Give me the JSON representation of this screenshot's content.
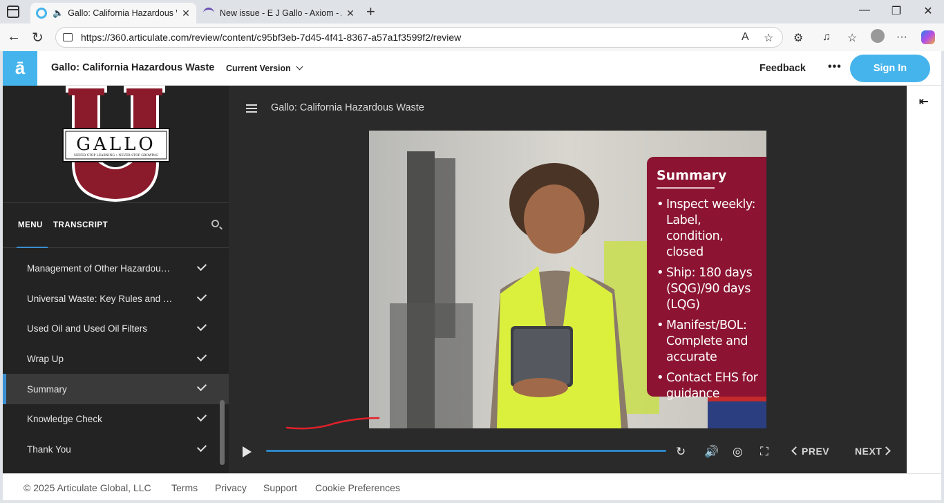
{
  "browser": {
    "tabs": [
      {
        "title": "Gallo: California Hazardous W",
        "active": true
      },
      {
        "title": "New issue - E J Gallo - Axiom - Ar",
        "active": false
      }
    ],
    "url": "https://360.articulate.com/review/content/c95bf3eb-7d45-4f41-8367-a57a1f3599f2/review"
  },
  "header": {
    "logo_letter": "ā",
    "course_title": "Gallo: California Hazardous Waste",
    "version_label": "Current Version",
    "feedback_label": "Feedback",
    "more_label": "•••",
    "signin_label": "Sign In"
  },
  "brand": {
    "word": "GALLO",
    "tagline": "NEVER STOP LEARNING • NEVER STOP GROWING"
  },
  "sidebar": {
    "tabs": [
      "MENU",
      "TRANSCRIPT"
    ],
    "items": [
      {
        "label": "Management of Other Hazardous Wa...",
        "completed": true,
        "selected": false
      },
      {
        "label": "Universal Waste: Key Rules and Limits",
        "completed": true,
        "selected": false
      },
      {
        "label": "Used Oil and Used Oil Filters",
        "completed": true,
        "selected": false
      },
      {
        "label": "Wrap Up",
        "completed": true,
        "selected": false
      },
      {
        "label": "Summary",
        "completed": true,
        "selected": true
      },
      {
        "label": "Knowledge Check",
        "completed": true,
        "selected": false
      },
      {
        "label": "Thank You",
        "completed": true,
        "selected": false
      }
    ]
  },
  "player": {
    "title": "Gallo: California Hazardous Waste",
    "progress": 1.0,
    "prev_label": "PREV",
    "next_label": "NEXT"
  },
  "slide": {
    "card_title": "Summary",
    "bullets": [
      "Inspect weekly: Label, condition, closed",
      "Ship: 180 days (SQG)/90 days (LQG)",
      "Manifest/BOL: Complete and accurate",
      "Contact EHS for guidance"
    ]
  },
  "footer": {
    "copyright": "© 2025 Articulate Global, LLC",
    "links": [
      "Terms",
      "Privacy",
      "Support",
      "Cookie Preferences"
    ]
  },
  "colors": {
    "accent": "#45b4ec",
    "progress": "#2b86c5",
    "card": "#8c1432",
    "sidebar": "#232323"
  }
}
